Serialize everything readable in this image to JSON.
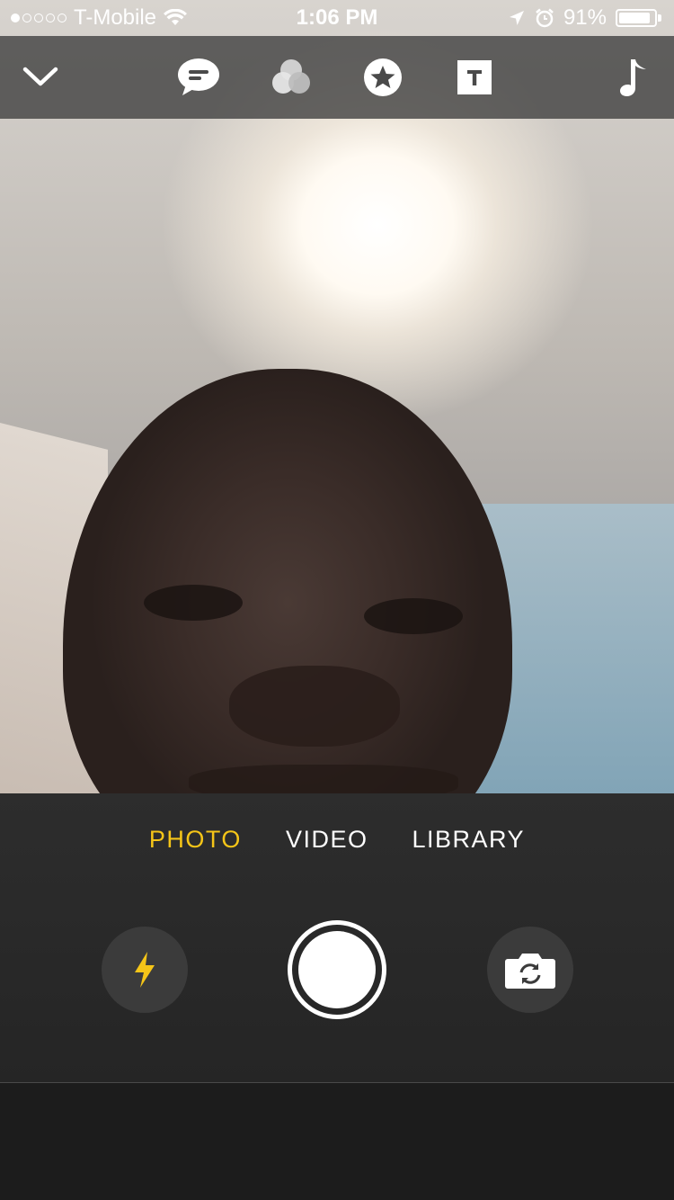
{
  "status_bar": {
    "carrier": "T-Mobile",
    "signal_bars_filled": 1,
    "signal_bars_total": 5,
    "time": "1:06 PM",
    "battery_percent": "91%",
    "battery_level": 0.91,
    "icons": [
      "wifi-icon",
      "location-arrow-icon",
      "alarm-icon",
      "battery-icon"
    ]
  },
  "toolbar": {
    "items": [
      {
        "name": "collapse",
        "icon": "chevron-down-icon"
      },
      {
        "name": "caption",
        "icon": "speech-bubble-icon"
      },
      {
        "name": "filters",
        "icon": "color-circles-icon"
      },
      {
        "name": "stickers",
        "icon": "star-badge-icon"
      },
      {
        "name": "text",
        "icon": "text-box-icon"
      },
      {
        "name": "music",
        "icon": "music-note-icon"
      }
    ]
  },
  "camera": {
    "modes": [
      "PHOTO",
      "VIDEO",
      "LIBRARY"
    ],
    "active_mode": "PHOTO",
    "accent_color": "#f5c518"
  },
  "controls": {
    "flash_icon": "lightning-bolt-icon",
    "shutter_icon": "shutter-button",
    "switch_icon": "camera-switch-icon"
  }
}
